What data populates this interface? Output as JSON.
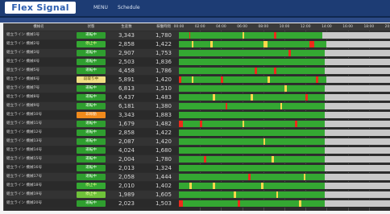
{
  "app": {
    "logo": "Flex Signal",
    "nav": {
      "menu": "MENU",
      "schedule": "Schedule"
    }
  },
  "table": {
    "headers": [
      "機械名",
      "状態",
      "生産数",
      "稼働時間"
    ],
    "time_labels": [
      "00:00",
      "02:00",
      "04:00",
      "06:00",
      "08:00",
      "10:00",
      "12:00",
      "14:00",
      "16:00",
      "18:00",
      "20:00"
    ],
    "status_colors": {
      "running": "#34a832",
      "stop": "#ffd84a",
      "error": "#ee2a1a",
      "idle": "#c9c9c9"
    },
    "rows": [
      {
        "name": "組立ライン 機械1号",
        "status": "運転中",
        "badge_color": "#2f9e2f",
        "badge_text": "#e8ffe8",
        "v1": "3,343",
        "v2": "1,780",
        "timeline": [
          [
            "running",
            0.0,
            0.05
          ],
          [
            "error",
            0.05,
            0.055
          ],
          [
            "running",
            0.055,
            0.3
          ],
          [
            "stop",
            0.3,
            0.31
          ],
          [
            "running",
            0.31,
            0.45
          ],
          [
            "error",
            0.45,
            0.46
          ],
          [
            "running",
            0.46,
            0.68
          ],
          [
            "idle",
            0.68,
            1.0
          ]
        ]
      },
      {
        "name": "組立ライン 機械2号",
        "status": "停止中",
        "badge_color": "#34a832",
        "badge_text": "#f0ff90",
        "v1": "2,858",
        "v2": "1,422",
        "timeline": [
          [
            "running",
            0.0,
            0.06
          ],
          [
            "stop",
            0.06,
            0.07
          ],
          [
            "running",
            0.07,
            0.15
          ],
          [
            "stop",
            0.15,
            0.16
          ],
          [
            "running",
            0.16,
            0.4
          ],
          [
            "stop",
            0.4,
            0.42
          ],
          [
            "running",
            0.42,
            0.62
          ],
          [
            "error",
            0.62,
            0.64
          ],
          [
            "running",
            0.64,
            0.7
          ],
          [
            "idle",
            0.7,
            1.0
          ]
        ]
      },
      {
        "name": "組立ライン 機械3号",
        "status": "運転中",
        "badge_color": "#2f9e2f",
        "badge_text": "#e8ffe8",
        "v1": "2,907",
        "v2": "1,753",
        "timeline": [
          [
            "running",
            0.0,
            0.52
          ],
          [
            "error",
            0.52,
            0.53
          ],
          [
            "running",
            0.53,
            0.69
          ],
          [
            "idle",
            0.69,
            1.0
          ]
        ]
      },
      {
        "name": "組立ライン 機械4号",
        "status": "運転中",
        "badge_color": "#2f9e2f",
        "badge_text": "#e8ffe8",
        "v1": "2,503",
        "v2": "1,836",
        "timeline": [
          [
            "running",
            0.0,
            0.69
          ],
          [
            "idle",
            0.69,
            1.0
          ]
        ]
      },
      {
        "name": "組立ライン 機械5号",
        "status": "運転中",
        "badge_color": "#2f9e2f",
        "badge_text": "#e8ffe8",
        "v1": "4,458",
        "v2": "1,786",
        "timeline": [
          [
            "running",
            0.0,
            0.36
          ],
          [
            "error",
            0.36,
            0.37
          ],
          [
            "running",
            0.37,
            0.45
          ],
          [
            "error",
            0.45,
            0.46
          ],
          [
            "running",
            0.46,
            0.69
          ],
          [
            "idle",
            0.69,
            1.0
          ]
        ]
      },
      {
        "name": "組立ライン 機械6号",
        "status": "段取り中",
        "badge_color": "#f1df84",
        "badge_text": "#4a3d00",
        "v1": "5,891",
        "v2": "1,420",
        "timeline": [
          [
            "error",
            0.0,
            0.01
          ],
          [
            "running",
            0.01,
            0.06
          ],
          [
            "stop",
            0.06,
            0.07
          ],
          [
            "running",
            0.07,
            0.2
          ],
          [
            "error",
            0.2,
            0.21
          ],
          [
            "running",
            0.21,
            0.42
          ],
          [
            "stop",
            0.42,
            0.43
          ],
          [
            "running",
            0.43,
            0.65
          ],
          [
            "error",
            0.65,
            0.66
          ],
          [
            "running",
            0.66,
            0.7
          ],
          [
            "idle",
            0.7,
            1.0
          ]
        ]
      },
      {
        "name": "組立ライン 機械7号",
        "status": "運転中",
        "badge_color": "#2f9e2f",
        "badge_text": "#e8ffe8",
        "v1": "6,813",
        "v2": "1,510",
        "timeline": [
          [
            "running",
            0.0,
            0.5
          ],
          [
            "stop",
            0.5,
            0.51
          ],
          [
            "running",
            0.51,
            0.69
          ],
          [
            "idle",
            0.69,
            1.0
          ]
        ]
      },
      {
        "name": "組立ライン 機械8号",
        "status": "運転中",
        "badge_color": "#2f9e2f",
        "badge_text": "#e8ffe8",
        "v1": "6,437",
        "v2": "1,483",
        "timeline": [
          [
            "running",
            0.0,
            0.16
          ],
          [
            "stop",
            0.16,
            0.17
          ],
          [
            "running",
            0.17,
            0.34
          ],
          [
            "stop",
            0.34,
            0.35
          ],
          [
            "running",
            0.35,
            0.6
          ],
          [
            "error",
            0.6,
            0.61
          ],
          [
            "running",
            0.61,
            0.69
          ],
          [
            "idle",
            0.69,
            1.0
          ]
        ]
      },
      {
        "name": "組立ライン 機械9号",
        "status": "運転中",
        "badge_color": "#2f9e2f",
        "badge_text": "#e8ffe8",
        "v1": "6,181",
        "v2": "1,380",
        "timeline": [
          [
            "running",
            0.0,
            0.22
          ],
          [
            "error",
            0.22,
            0.23
          ],
          [
            "running",
            0.23,
            0.48
          ],
          [
            "stop",
            0.48,
            0.49
          ],
          [
            "running",
            0.49,
            0.69
          ],
          [
            "idle",
            0.69,
            1.0
          ]
        ]
      },
      {
        "name": "組立ライン 機械10号",
        "status": "非稼動",
        "badge_color": "#f08a1c",
        "badge_text": "#fff2e0",
        "v1": "3,343",
        "v2": "1,883",
        "timeline": [
          [
            "running",
            0.0,
            0.69
          ],
          [
            "idle",
            0.69,
            1.0
          ]
        ]
      },
      {
        "name": "組立ライン 機械11号",
        "status": "運転中",
        "badge_color": "#2f9e2f",
        "badge_text": "#e8ffe8",
        "v1": "1,679",
        "v2": "1,482",
        "timeline": [
          [
            "error",
            0.0,
            0.02
          ],
          [
            "running",
            0.02,
            0.1
          ],
          [
            "error",
            0.1,
            0.11
          ],
          [
            "running",
            0.11,
            0.3
          ],
          [
            "stop",
            0.3,
            0.31
          ],
          [
            "running",
            0.31,
            0.55
          ],
          [
            "error",
            0.55,
            0.56
          ],
          [
            "running",
            0.56,
            0.69
          ],
          [
            "idle",
            0.69,
            1.0
          ]
        ]
      },
      {
        "name": "組立ライン 機械12号",
        "status": "運転中",
        "badge_color": "#2f9e2f",
        "badge_text": "#e8ffe8",
        "v1": "2,858",
        "v2": "1,422",
        "timeline": [
          [
            "running",
            0.0,
            0.69
          ],
          [
            "idle",
            0.69,
            1.0
          ]
        ]
      },
      {
        "name": "組立ライン 機械13号",
        "status": "運転中",
        "badge_color": "#2f9e2f",
        "badge_text": "#e8ffe8",
        "v1": "2,087",
        "v2": "1,420",
        "timeline": [
          [
            "running",
            0.0,
            0.4
          ],
          [
            "stop",
            0.4,
            0.41
          ],
          [
            "running",
            0.41,
            0.69
          ],
          [
            "idle",
            0.69,
            1.0
          ]
        ]
      },
      {
        "name": "組立ライン 機械14号",
        "status": "運転中",
        "badge_color": "#2f9e2f",
        "badge_text": "#e8ffe8",
        "v1": "4,024",
        "v2": "1,680",
        "timeline": [
          [
            "running",
            0.0,
            0.69
          ],
          [
            "idle",
            0.69,
            1.0
          ]
        ]
      },
      {
        "name": "組立ライン 機械15号",
        "status": "運転中",
        "badge_color": "#2f9e2f",
        "badge_text": "#e8ffe8",
        "v1": "2,004",
        "v2": "1,780",
        "timeline": [
          [
            "running",
            0.0,
            0.12
          ],
          [
            "error",
            0.12,
            0.13
          ],
          [
            "running",
            0.13,
            0.44
          ],
          [
            "stop",
            0.44,
            0.45
          ],
          [
            "running",
            0.45,
            0.69
          ],
          [
            "idle",
            0.69,
            1.0
          ]
        ]
      },
      {
        "name": "組立ライン 機械16号",
        "status": "運転中",
        "badge_color": "#2f9e2f",
        "badge_text": "#e8ffe8",
        "v1": "2,013",
        "v2": "1,324",
        "timeline": [
          [
            "running",
            0.0,
            0.69
          ],
          [
            "idle",
            0.69,
            1.0
          ]
        ]
      },
      {
        "name": "組立ライン 機械17号",
        "status": "運転中",
        "badge_color": "#2f9e2f",
        "badge_text": "#e8ffe8",
        "v1": "2,058",
        "v2": "1,444",
        "timeline": [
          [
            "running",
            0.0,
            0.33
          ],
          [
            "error",
            0.33,
            0.34
          ],
          [
            "running",
            0.34,
            0.59
          ],
          [
            "stop",
            0.59,
            0.6
          ],
          [
            "running",
            0.6,
            0.69
          ],
          [
            "idle",
            0.69,
            1.0
          ]
        ]
      },
      {
        "name": "組立ライン 機械18号",
        "status": "停止中",
        "badge_color": "#34a832",
        "badge_text": "#f0ff90",
        "v1": "2,010",
        "v2": "1,402",
        "timeline": [
          [
            "running",
            0.0,
            0.05
          ],
          [
            "stop",
            0.05,
            0.06
          ],
          [
            "running",
            0.06,
            0.16
          ],
          [
            "stop",
            0.16,
            0.17
          ],
          [
            "running",
            0.17,
            0.39
          ],
          [
            "stop",
            0.39,
            0.4
          ],
          [
            "running",
            0.4,
            0.69
          ],
          [
            "idle",
            0.69,
            1.0
          ]
        ]
      },
      {
        "name": "組立ライン 機械19号",
        "status": "停止中",
        "badge_color": "#6fc23a",
        "badge_text": "#f7ffb0",
        "v1": "1,989",
        "v2": "1,605",
        "timeline": [
          [
            "running",
            0.0,
            0.26
          ],
          [
            "stop",
            0.26,
            0.27
          ],
          [
            "running",
            0.27,
            0.46
          ],
          [
            "stop",
            0.46,
            0.47
          ],
          [
            "running",
            0.47,
            0.69
          ],
          [
            "idle",
            0.69,
            1.0
          ]
        ]
      },
      {
        "name": "組立ライン 機械20号",
        "status": "運転中",
        "badge_color": "#2f9e2f",
        "badge_text": "#e8ffe8",
        "v1": "2,023",
        "v2": "1,503",
        "timeline": [
          [
            "error",
            0.0,
            0.02
          ],
          [
            "running",
            0.02,
            0.28
          ],
          [
            "error",
            0.28,
            0.29
          ],
          [
            "running",
            0.29,
            0.57
          ],
          [
            "stop",
            0.57,
            0.58
          ],
          [
            "running",
            0.58,
            0.69
          ],
          [
            "idle",
            0.69,
            1.0
          ]
        ]
      }
    ]
  }
}
